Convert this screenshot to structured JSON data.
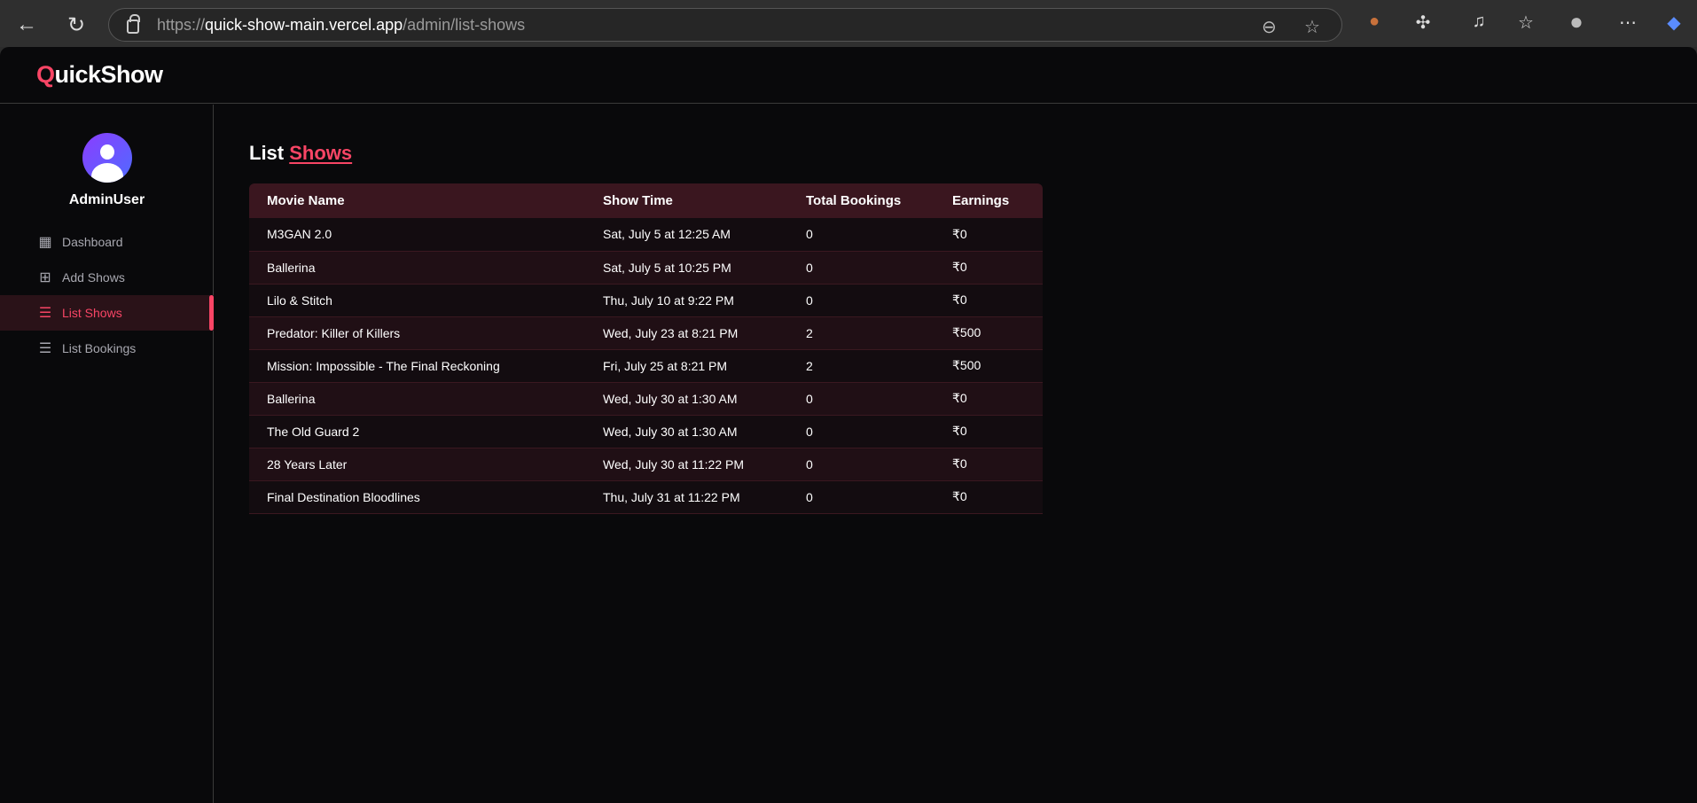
{
  "browser": {
    "url_scheme": "https://",
    "url_host": "quick-show-main.vercel.app",
    "url_path": "/admin/list-shows"
  },
  "app": {
    "logo_first": "Q",
    "logo_rest": "uickShow"
  },
  "sidebar": {
    "username": "AdminUser",
    "items": [
      {
        "label": "Dashboard",
        "icon": "dashboard-icon"
      },
      {
        "label": "Add Shows",
        "icon": "plus-square-icon"
      },
      {
        "label": "List Shows",
        "icon": "list-icon",
        "active": true
      },
      {
        "label": "List Bookings",
        "icon": "list-ordered-icon"
      }
    ]
  },
  "page": {
    "title_plain": "List",
    "title_accent": "Shows"
  },
  "table": {
    "headers": [
      "Movie Name",
      "Show Time",
      "Total Bookings",
      "Earnings"
    ],
    "rows": [
      [
        "M3GAN 2.0",
        "Sat, July 5 at 12:25 AM",
        "0",
        "₹0"
      ],
      [
        "Ballerina",
        "Sat, July 5 at 10:25 PM",
        "0",
        "₹0"
      ],
      [
        "Lilo & Stitch",
        "Thu, July 10 at 9:22 PM",
        "0",
        "₹0"
      ],
      [
        "Predator: Killer of Killers",
        "Wed, July 23 at 8:21 PM",
        "2",
        "₹500"
      ],
      [
        "Mission: Impossible - The Final Reckoning",
        "Fri, July 25 at 8:21 PM",
        "2",
        "₹500"
      ],
      [
        "Ballerina",
        "Wed, July 30 at 1:30 AM",
        "0",
        "₹0"
      ],
      [
        "The Old Guard 2",
        "Wed, July 30 at 1:30 AM",
        "0",
        "₹0"
      ],
      [
        "28 Years Later",
        "Wed, July 30 at 11:22 PM",
        "0",
        "₹0"
      ],
      [
        "Final Destination Bloodlines",
        "Thu, July 31 at 11:22 PM",
        "0",
        "₹0"
      ]
    ]
  },
  "colors": {
    "accent": "#f84565",
    "background": "#09090b",
    "table_header": "#3a161f"
  }
}
